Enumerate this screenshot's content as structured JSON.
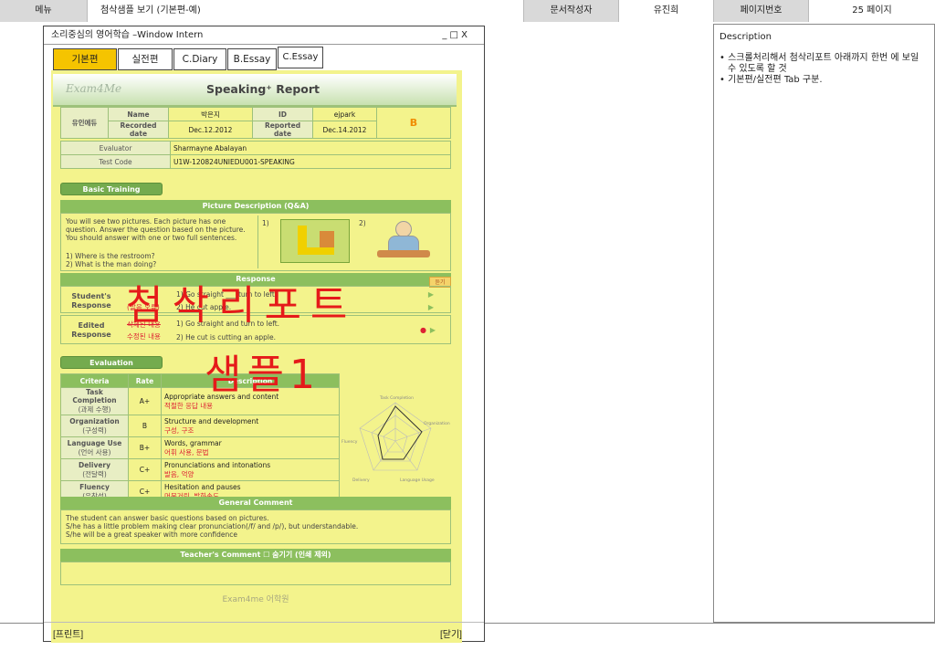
{
  "header": {
    "menu_label": "메뉴",
    "menu_value": "첨삭샘플 보기 (기본편-예)",
    "author_label": "문서작성자",
    "author_value": "유진희",
    "page_label": "페이지번호",
    "page_value": "25 페이지"
  },
  "description": {
    "title": "Description",
    "items": [
      "• 스크롤처리해서 첨삭리포트 아래까지 한번 에 보일 수 있도록 할 것",
      "• 기본편/실전편 Tab 구분."
    ]
  },
  "window": {
    "title": "소리중심의 영어학습 –Window Intern",
    "controls": "_ □ X",
    "tabs": [
      "기본편",
      "실전편",
      "C.Diary",
      "B.Essay",
      "C.Essay"
    ],
    "print_label": "[프린트]",
    "close_label": "[닫기]"
  },
  "report": {
    "logo": "Exam4Me",
    "title": "Speaking⁺ Report",
    "info": {
      "group": "유인에듀",
      "name_label": "Name",
      "name_value": "박은지",
      "id_label": "ID",
      "id_value": "ejpark",
      "grade": "B",
      "recorded_label": "Recorded date",
      "recorded_value": "Dec.12.2012",
      "reported_label": "Reported date",
      "reported_value": "Dec.14.2012"
    },
    "evaluator_label": "Evaluator",
    "evaluator_value": "Sharmayne Abalayan",
    "testcode_label": "Test Code",
    "testcode_value": "U1W-120824UNIEDU001-SPEAKING",
    "basic_training": "Basic Training",
    "picture_header": "Picture Description  (Q&A)",
    "picture_text": "You will see two pictures. Each picture has one question. Answer the question based on the picture. You should answer with one or two full sentences.",
    "questions": [
      "1)   Where is the restroom?",
      "2)   What is the man doing?"
    ],
    "pic_labels": [
      "1)",
      "2)"
    ],
    "response_header": "Response",
    "listen": "듣기",
    "student_label": "Student's Response",
    "student_answers": [
      "1) Go straight ___ turn to left.",
      "2) He cut apple."
    ],
    "student_note": "(발음 오류)",
    "edited_label": "Edited Response",
    "edited_answers": [
      "1) Go straight and turn to left.",
      "2) He cut is cutting an apple."
    ],
    "edited_note1": "삭제된 내용",
    "edited_note2": "수정된 내용",
    "evaluation": "Evaluation",
    "eval_headers": [
      "Criteria",
      "Rate",
      "Description"
    ],
    "eval_rows": [
      {
        "criteria": "Task Completion",
        "kr": "(과제 수행)",
        "rate": "A+",
        "desc": "Appropriate answers and content",
        "desc_kr": "적절한 응답 내용"
      },
      {
        "criteria": "Organization",
        "kr": "(구성력)",
        "rate": "B",
        "desc": "Structure and development",
        "desc_kr": "구성, 구조"
      },
      {
        "criteria": "Language Use",
        "kr": "(언어 사용)",
        "rate": "B+",
        "desc": "Words, grammar",
        "desc_kr": "어휘 사용, 문법"
      },
      {
        "criteria": "Delivery",
        "kr": "(전달력)",
        "rate": "C+",
        "desc": "Pronunciations and intonations",
        "desc_kr": "발음, 억양"
      },
      {
        "criteria": "Fluency",
        "kr": "(유창성)",
        "rate": "C+",
        "desc": "Hesitation and pauses",
        "desc_kr": "머뭇거림, 발화속도"
      }
    ],
    "radar_labels": [
      "Task Completion",
      "Organization",
      "Language  Usage",
      "Delivery",
      "Fluency"
    ],
    "general_comment_header": "General Comment",
    "general_comment": [
      "The student can answer basic questions based on pictures.",
      "S/he has a little problem making clear pronunciation(/f/ and /p/), but understandable.",
      "S/he will be a great speaker with more confidence"
    ],
    "teacher_comment_header": "Teacher's Comment ☐ 숨기기 (인쇄 제외)",
    "footer": "Exam4me 어학원"
  },
  "watermark": {
    "line1": "첨삭리포트",
    "line2": "샘플1"
  }
}
